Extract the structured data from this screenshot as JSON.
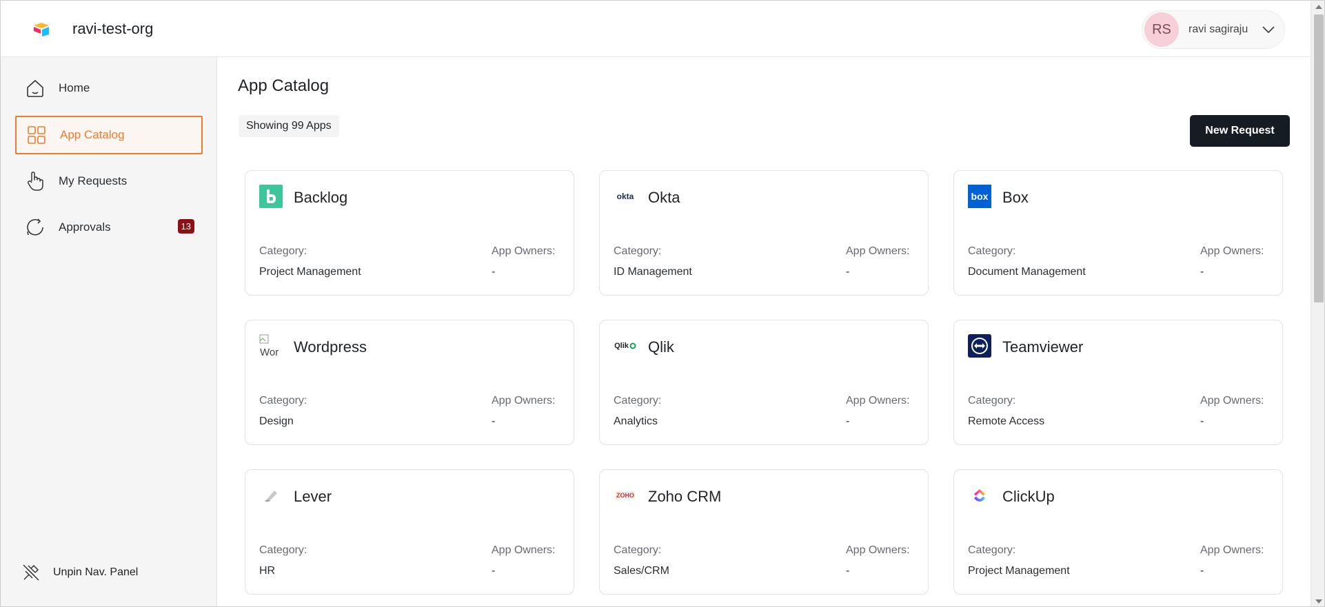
{
  "header": {
    "org_name": "ravi-test-org",
    "user": {
      "initials": "RS",
      "name": "ravi sagiraju"
    }
  },
  "sidebar": {
    "items": [
      {
        "label": "Home",
        "icon": "home-icon"
      },
      {
        "label": "App Catalog",
        "icon": "grid-icon",
        "active": true
      },
      {
        "label": "My Requests",
        "icon": "hand-pointer-icon"
      },
      {
        "label": "Approvals",
        "icon": "refresh-chat-icon",
        "badge": "13"
      }
    ],
    "unpin_label": "Unpin Nav. Panel"
  },
  "main": {
    "title": "App Catalog",
    "count_text": "Showing 99 Apps",
    "new_request_label": "New Request",
    "category_label": "Category:",
    "owners_label": "App Owners:",
    "apps": [
      {
        "name": "Backlog",
        "category": "Project Management",
        "owners": "-"
      },
      {
        "name": "Okta",
        "category": "ID Management",
        "owners": "-"
      },
      {
        "name": "Box",
        "category": "Document Management",
        "owners": "-"
      },
      {
        "name": "Wordpress",
        "category": "Design",
        "owners": "-"
      },
      {
        "name": "Qlik",
        "category": "Analytics",
        "owners": "-"
      },
      {
        "name": "Teamviewer",
        "category": "Remote Access",
        "owners": "-"
      },
      {
        "name": "Lever",
        "category": "HR",
        "owners": "-"
      },
      {
        "name": "Zoho CRM",
        "category": "Sales/CRM",
        "owners": "-"
      },
      {
        "name": "ClickUp",
        "category": "Project Management",
        "owners": "-"
      }
    ],
    "logo_texts": {
      "okta": "okta",
      "box": "box",
      "qlik": "Qlik",
      "wordpress_alt": "Wor",
      "zoho": "ZOHO"
    }
  },
  "colors": {
    "accent": "#ee7a2c",
    "badge": "#8f0f14",
    "button": "#161c24",
    "backlog": "#3fc59b",
    "box": "#0061d5",
    "teamviewer": "#0e1f5b"
  }
}
